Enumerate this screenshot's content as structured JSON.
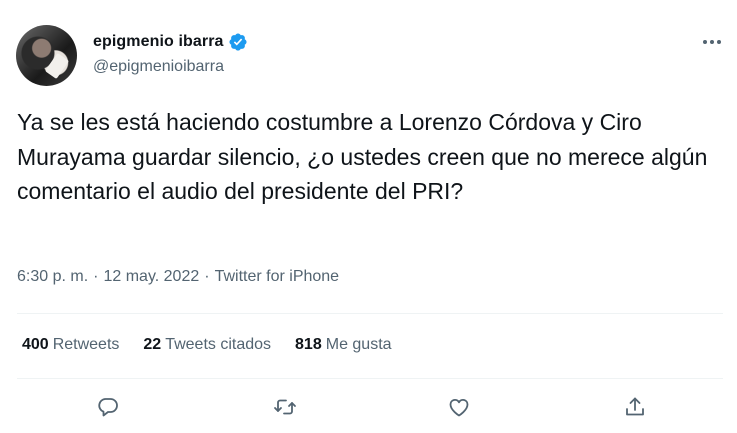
{
  "author": {
    "display_name": "epigmenio ibarra",
    "handle": "@epigmenioibarra",
    "verified": true
  },
  "tweet": {
    "text": "Ya se les está haciendo costumbre a Lorenzo Córdova y Ciro Murayama guardar silencio, ¿o ustedes creen que no merece algún comentario el audio del presidente del PRI?",
    "time": "6:30 p. m.",
    "date": "12 may. 2022",
    "source": "Twitter for iPhone",
    "separator": "·"
  },
  "stats": {
    "retweets_count": "400",
    "retweets_label": "Retweets",
    "quotes_count": "22",
    "quotes_label": "Tweets citados",
    "likes_count": "818",
    "likes_label": "Me gusta"
  },
  "icons": {
    "verified": "verified-badge-icon",
    "more": "more-horizontal-icon",
    "reply": "reply-icon",
    "retweet": "retweet-icon",
    "like": "heart-icon",
    "share": "share-icon"
  },
  "colors": {
    "text": "#0f1419",
    "secondary": "#536471",
    "verified": "#1d9bf0",
    "divider": "#eff3f4"
  }
}
